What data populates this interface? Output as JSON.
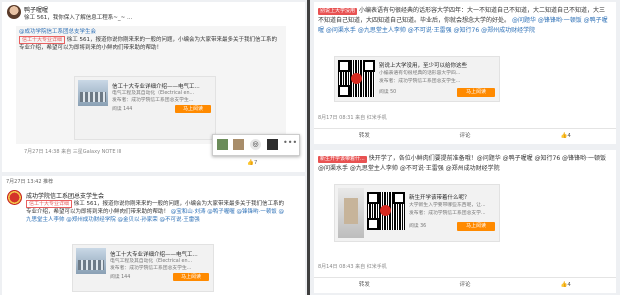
{
  "left": {
    "post1": {
      "author": "鸭子喔喔",
      "text": "徐工 561，我你保入了解信息工程系~_~ ...",
      "quote_prefix": "@成功学院信工系团总支学生会",
      "quote_tag": "信工十大专业详细",
      "quote_body": "徐工 561，报道你说你刚来来的一般的问题，小编会为大家带来最多关于我们信工系的专业介绍，希望可以为即将到来的小鲜肉们带来助的帮助！",
      "share_title": "信工十大专业详细介绍——电气工...",
      "share_sub1": "电气工程及其自动化（Electrical en...",
      "share_sub2": "发布者：成功学院信工系团总支学生...",
      "share_reads": "阅读 144",
      "share_btn": "马上阅读",
      "meta": "7月27日 14:38 来自 三星Galaxy NOTE III",
      "like_count": "7"
    },
    "post2": {
      "time": "7月27日 13:42 推荐",
      "author": "成功学院信工系团总支学生会",
      "tag": "信工十大专业详细",
      "body": "徐工 561，报道你说你刚来来的一般的问题，小编会为大家带来最多关于我们信工系的专业介绍，希望可以为即将到来的小鲜肉们带来助的帮助！",
      "mentions": "@宝和山·刘涛 @鸭子喔喔 @锋锋哟·一顿饭 @九思堂主人李帅 @郑州成功财经学院 @金贝以·孙家荣 @不可说·王雷强",
      "share_title": "信工十大专业详细介绍——电气工...",
      "share_sub1": "电气工程及其自动化（Electrical en...",
      "share_sub2": "发布者：成功学院信工系团总支学生...",
      "share_reads": "阅读 144",
      "share_btn": "马上阅读"
    },
    "popover_icons": [
      "avatar-a",
      "avatar-b",
      "repost-icon",
      "avatar-c",
      "more-icon"
    ]
  },
  "right": {
    "post1": {
      "tag": "别说上大学没用",
      "body": "小编表语有句很经典的话形容大学四年：大一不知道自己不知道，大二知道自己不知道，大三不知道自己知道，大四知道自己知道。毕业后，你就会想念大学的好处。",
      "mentions": "@问题华 @锋锋哟·一顿饭 @鸭子喔喔 @问渠水手 @九思堂主人李帅 @不可说·王雷强 @知行76 @郑州成功财经学院",
      "share_title": "别说上大学没用，至少可以给你这些",
      "share_sub1": "小编表语有句很经典的话形容大学四...",
      "share_sub2": "发布者：成功学院信工系团总支学生...",
      "share_reads": "阅读 50",
      "share_btn": "马上阅读",
      "meta": "8月17日 08:31 来自 红米手机",
      "actions": [
        "转发",
        "评论",
        "4"
      ]
    },
    "post2": {
      "tag": "新生开学该带着什...",
      "body": "快开学了，各位小鲜肉们要提前准备哦！@问题华 @鸭子喔喔 @知行76 @锋锋哟·一顿饭 @问渠水手 @九思堂主人李帅 @不可说·王雷强 @郑州成功财经学院",
      "share_title": "新生开学该带着什么呢？",
      "share_sub1": "大学新生入学要带哪些东西呢，让...",
      "share_sub2": "发布者：成功学院信工系团总支学...",
      "share_reads": "阅读 36",
      "share_btn": "马上阅读",
      "meta": "8月14日 08:43 来自 红米手机",
      "actions": [
        "转发",
        "评论",
        "4"
      ]
    }
  }
}
